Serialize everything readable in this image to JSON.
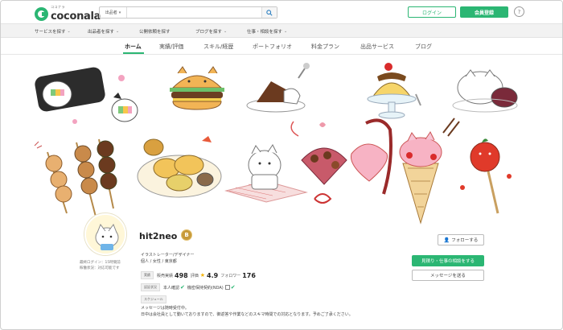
{
  "header": {
    "logo_small": "ココナラ",
    "logo_text": "coconala",
    "search_category": "出品者",
    "search_placeholder": "",
    "login_label": "ログイン",
    "register_label": "会員登録",
    "help_label": "?"
  },
  "subnav": {
    "items": [
      {
        "label": "サービスを探す",
        "has_chevron": true
      },
      {
        "label": "出品者を探す",
        "has_chevron": true
      },
      {
        "label": "公開依頼を探す",
        "has_chevron": false
      },
      {
        "label": "ブログを探す",
        "has_chevron": true
      },
      {
        "label": "仕事・相談を探す",
        "has_chevron": true
      }
    ]
  },
  "tabs": {
    "items": [
      "ホーム",
      "実績/評価",
      "スキル/経歴",
      "ポートフォリオ",
      "料金プラン",
      "出品サービス",
      "ブログ"
    ],
    "active_index": 0
  },
  "profile": {
    "username": "hit2neo",
    "rank_badge": "B",
    "login_line1": "最終ログイン：15時間前",
    "login_line2": "稼働状況：対応可能です",
    "role_line1": "イラストレーター/デザイナー",
    "role_line2": "個人 / 女性 / 東京都",
    "stats": {
      "tag": "実績",
      "sales_label": "販売実績",
      "sales_value": "498",
      "rating_label": "評価",
      "rating_value": "4.9",
      "followers_label": "フォロワー",
      "followers_value": "176"
    },
    "verify": {
      "tag": "認証状況",
      "identity_label": "本人確認",
      "nda_label": "機密保持契約(NDA)"
    },
    "schedule": {
      "tag": "スケジュール",
      "line1": "メッセージは随時受付中。",
      "line2": "日中は会社員として動いておりますので、御返答や作業などのスキマ時間での対応となります。予めご了承ください。"
    }
  },
  "actions": {
    "follow_label": "フォローする",
    "consult_label": "見積り・仕事の相談をする",
    "message_label": "メッセージを送る"
  },
  "colors": {
    "brand_green": "#2bb673",
    "rank_gold": "#c79a3a",
    "star": "#f5b400"
  }
}
